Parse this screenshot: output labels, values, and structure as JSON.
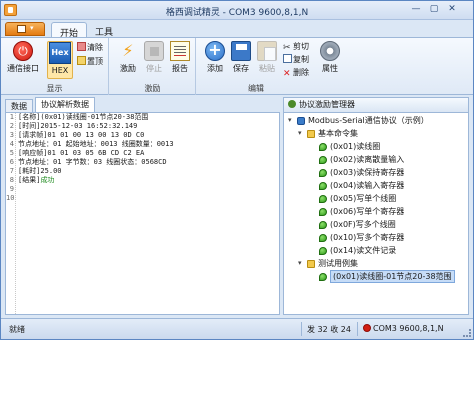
{
  "window": {
    "title": "格西调试精灵 - COM3  9600,8,1,N",
    "controls": {
      "minimize": "—",
      "maximize": "▢",
      "close": "✕"
    }
  },
  "ribbon": {
    "menu_button_arrow": "▾",
    "tabs": [
      {
        "label": "开始",
        "active": true
      },
      {
        "label": "工具",
        "active": false
      }
    ],
    "groups": {
      "display": {
        "label": "显示",
        "comm_port": "通信接口",
        "hex": "HEX",
        "hex_icon_text": "Hex",
        "clear": "清除",
        "pin_top": "置顶"
      },
      "stimulus": {
        "label": "激励",
        "stimulus_btn": "激励",
        "stop_btn": "停止",
        "report_btn": "报告"
      },
      "edit": {
        "label": "编辑",
        "add": "添加",
        "save": "保存",
        "paste": "粘贴",
        "cut": "剪切",
        "copy": "复制",
        "delete": "删除",
        "properties": "属性"
      }
    }
  },
  "left_pane": {
    "tabs": [
      {
        "label": "数据",
        "active": false
      },
      {
        "label": "协议解析数据",
        "active": true
      }
    ],
    "line_numbers": [
      "1",
      "2",
      "3",
      "4",
      "5",
      "6",
      "7",
      "8",
      "9",
      "10"
    ],
    "lines": [
      {
        "text": "[名称](0x01)读线圈-01节点20-38范围",
        "status": ""
      },
      {
        "text": "[时间]2015-12-03 16:52:32.149",
        "status": ""
      },
      {
        "text": "[请求帧]01 01 00 13 00 13 0D C0",
        "status": ""
      },
      {
        "text": "  节点地址：01  起始地址：0013  线圈数量：0013",
        "status": ""
      },
      {
        "text": "[响应帧]01 01 03 05 6B CD C2 EA",
        "status": ""
      },
      {
        "text": "  节点地址：01  字节数：03  线圈状态：0568CD",
        "status": ""
      },
      {
        "text": "[耗时]25.00",
        "status": ""
      },
      {
        "text": "[结果]",
        "status": "成功"
      },
      {
        "text": "",
        "status": ""
      },
      {
        "text": "",
        "status": ""
      }
    ]
  },
  "right_pane": {
    "title": "协议激励管理器",
    "tree": [
      {
        "label": "Modbus-Serial通信协议（示例）",
        "level": 0,
        "type": "root",
        "expander": "▾",
        "selected": false
      },
      {
        "label": "基本命令集",
        "level": 1,
        "type": "folder",
        "expander": "▾",
        "selected": false
      },
      {
        "label": "(0x01)读线圈",
        "level": 2,
        "type": "leaf",
        "expander": "",
        "selected": false
      },
      {
        "label": "(0x02)读离散量输入",
        "level": 2,
        "type": "leaf",
        "expander": "",
        "selected": false
      },
      {
        "label": "(0x03)读保持寄存器",
        "level": 2,
        "type": "leaf",
        "expander": "",
        "selected": false
      },
      {
        "label": "(0x04)读输入寄存器",
        "level": 2,
        "type": "leaf",
        "expander": "",
        "selected": false
      },
      {
        "label": "(0x05)写单个线圈",
        "level": 2,
        "type": "leaf",
        "expander": "",
        "selected": false
      },
      {
        "label": "(0x06)写单个寄存器",
        "level": 2,
        "type": "leaf",
        "expander": "",
        "selected": false
      },
      {
        "label": "(0x0F)写多个线圈",
        "level": 2,
        "type": "leaf",
        "expander": "",
        "selected": false
      },
      {
        "label": "(0x10)写多个寄存器",
        "level": 2,
        "type": "leaf",
        "expander": "",
        "selected": false
      },
      {
        "label": "(0x14)读文件记录",
        "level": 2,
        "type": "leaf",
        "expander": "",
        "selected": false
      },
      {
        "label": "测试用例集",
        "level": 1,
        "type": "folder",
        "expander": "▾",
        "selected": false
      },
      {
        "label": "(0x01)读线圈-01节点20-38范围",
        "level": 2,
        "type": "leaf",
        "expander": "",
        "selected": true
      }
    ]
  },
  "statusbar": {
    "ready": "就绪",
    "position": "发 32 收 24",
    "connection": "COM3  9600,8,1,N"
  },
  "colors": {
    "accent": "#3b7cc9",
    "success_text": "#1e8a1e",
    "status_error_dot": "#d21e12"
  }
}
